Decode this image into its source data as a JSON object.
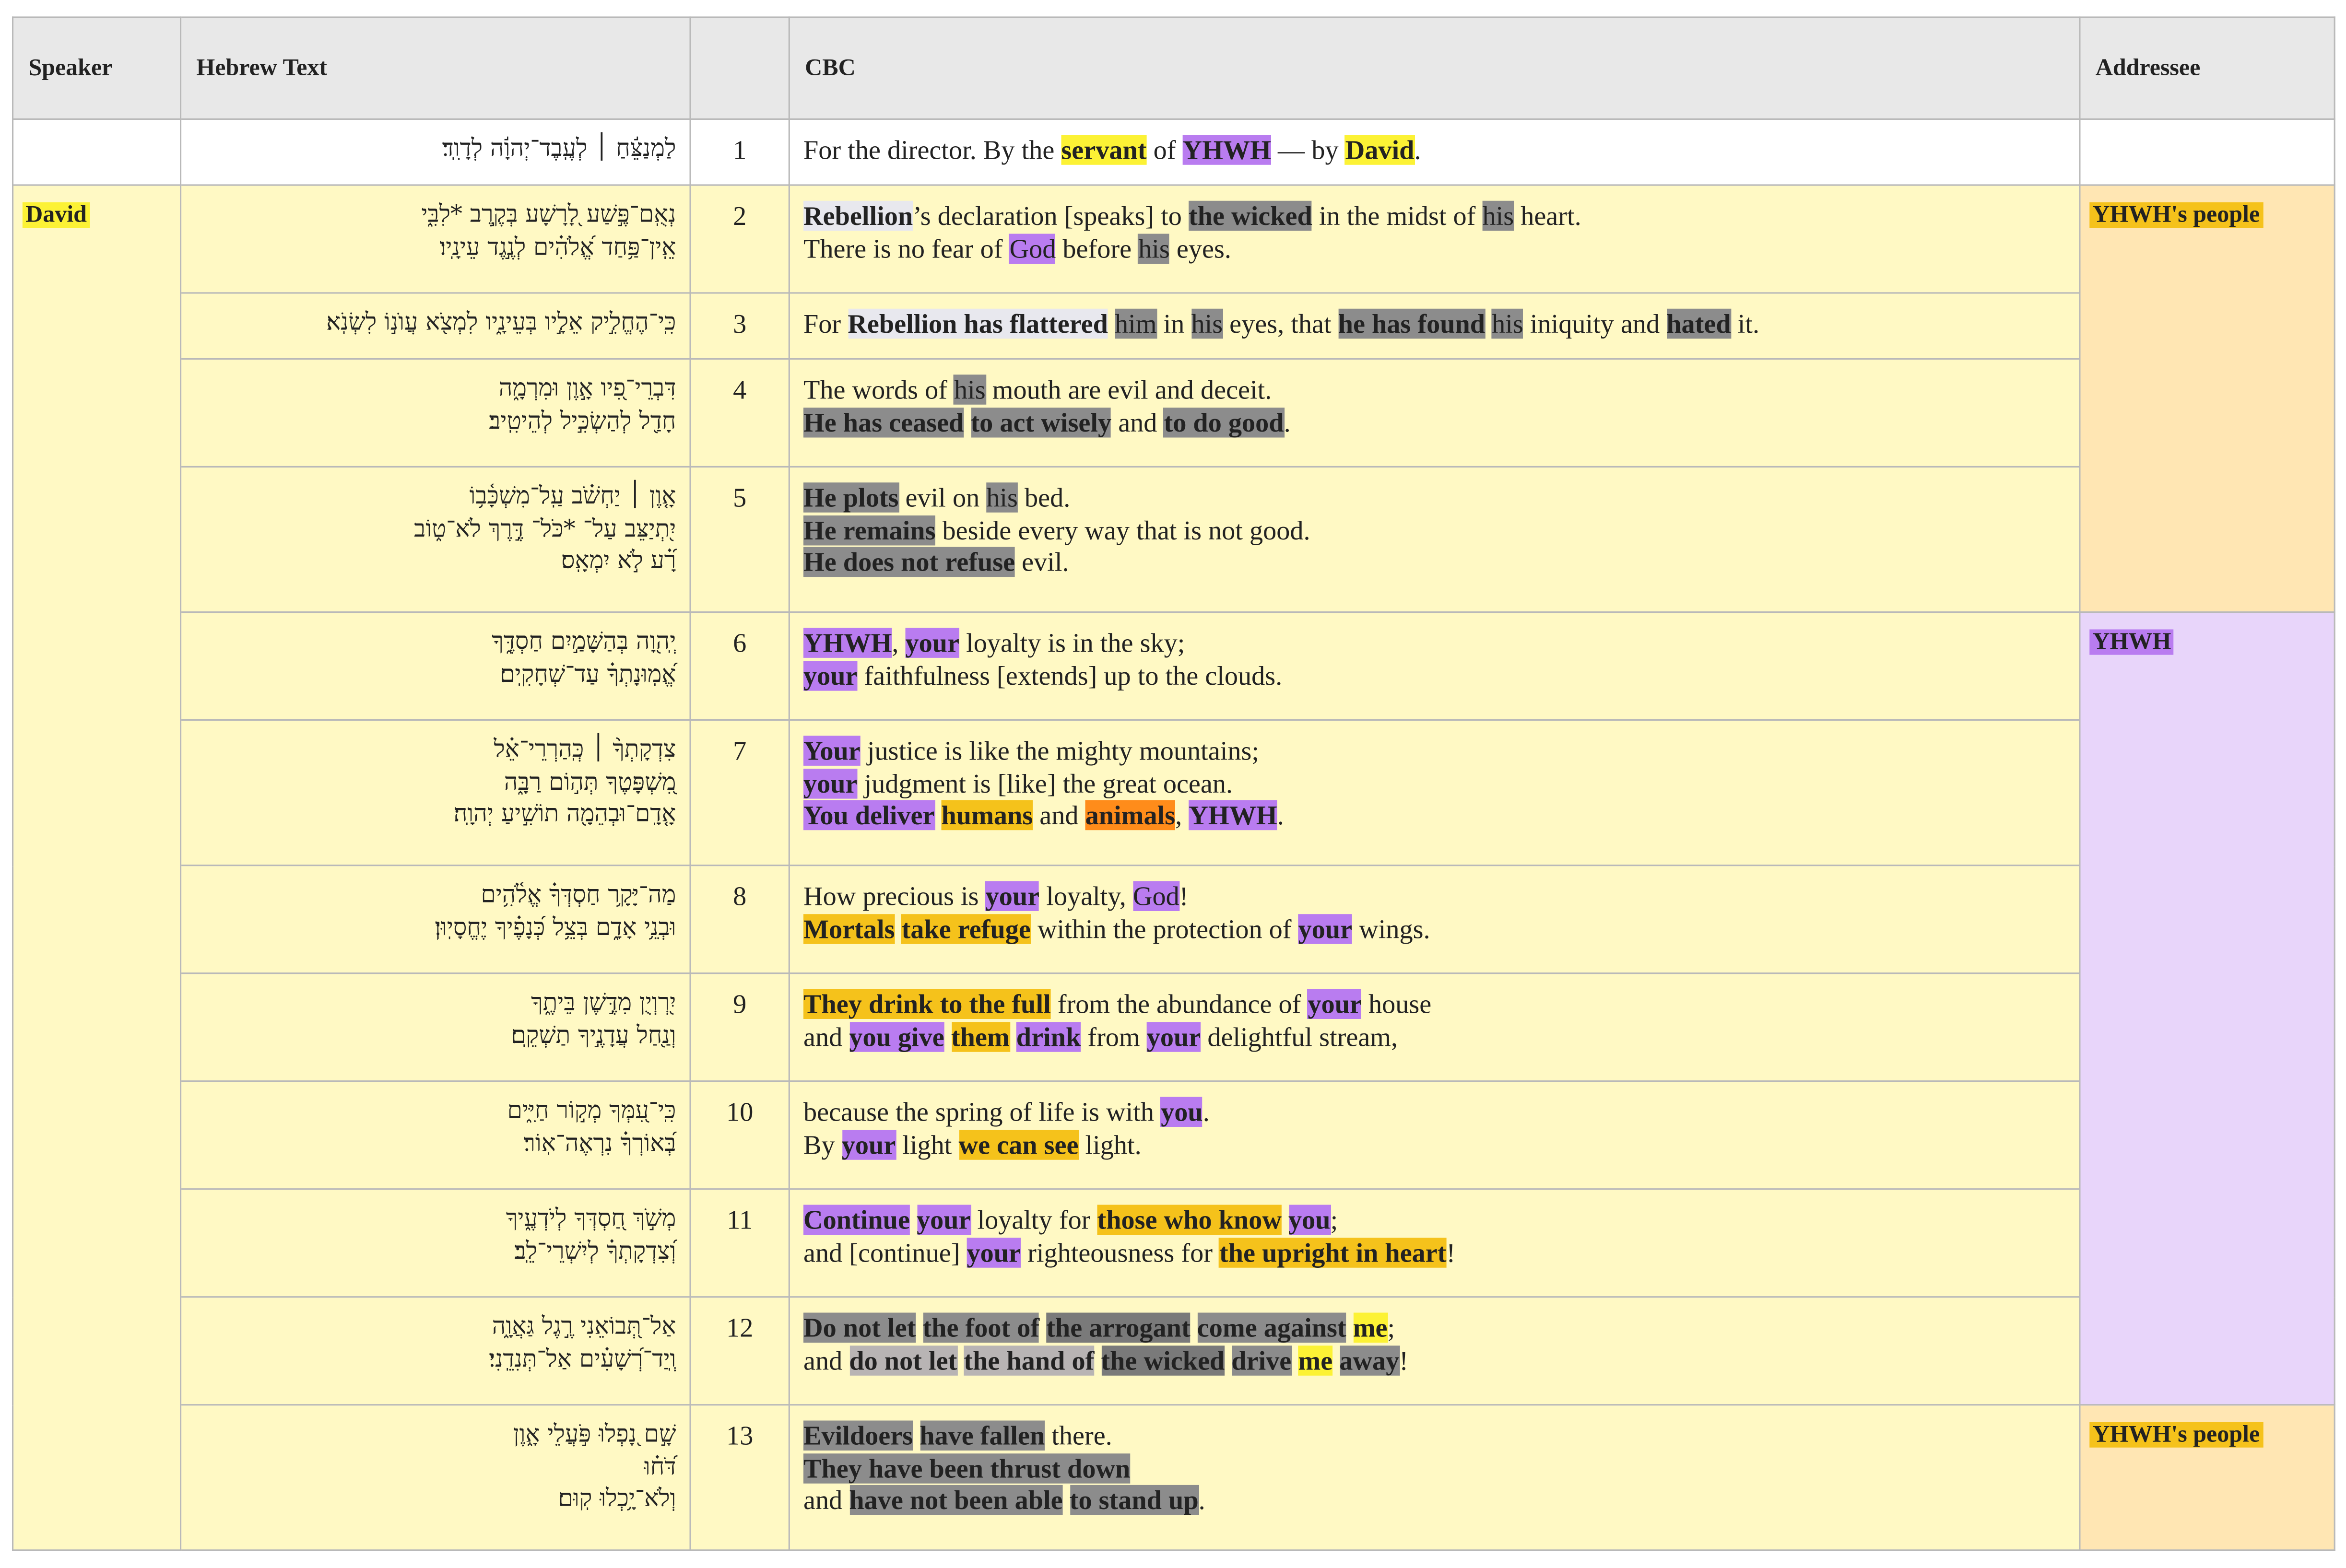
{
  "headers": {
    "speaker": "Speaker",
    "hebrew": "Hebrew Text",
    "number": "",
    "cbc": "CBC",
    "addressee": "Addressee"
  },
  "speaker_label": "David",
  "addressees": {
    "people_1": "YHWH's people",
    "yhwh": "YHWH",
    "people_2": "YHWH's people"
  },
  "colors": {
    "yellow": "#fcf235",
    "purple": "#b97cf0",
    "orange": "#f5c21b",
    "dark_orange": "#ff8c1a",
    "gray": "#8c8c8c",
    "light_gray": "#e8e8ee",
    "row_bg": "#fff9c4",
    "people_bg": "#ffe6b3",
    "yhwh_bg": "#e8d5fa"
  },
  "verses": [
    {
      "n": "1",
      "hebrew": [
        "לַמְנַצֵּ֬חַ ׀ לְעֶֽבֶד־יְהוָ֬ה לְדָוִֽד׃"
      ],
      "cbc": [
        [
          [
            "For the director. By the ",
            ""
          ],
          [
            "servant",
            "yellow b"
          ],
          [
            " of ",
            ""
          ],
          [
            "YHWH",
            "purple b"
          ],
          [
            " — by ",
            ""
          ],
          [
            "David",
            "yellow b"
          ],
          [
            ".",
            ""
          ]
        ]
      ]
    },
    {
      "n": "2",
      "hebrew": [
        "נְאֻֽם־פֶּ֣שַׁע לָ֭רָשָׁע בְּקֶ֣רֶב *לִבִּ֑י",
        "אֵֽין־פַּ֥חַד אֱ֝לֹהִ֗ים לְנֶ֣גֶד עֵינָֽיו׃"
      ],
      "cbc": [
        [
          [
            "Rebellion",
            "lgray b"
          ],
          [
            "’s declaration [speaks] to ",
            ""
          ],
          [
            "the wicked",
            "gray b"
          ],
          [
            " in the midst of ",
            ""
          ],
          [
            "his",
            "gray"
          ],
          [
            " heart.",
            ""
          ]
        ],
        [
          [
            "There is no fear of ",
            ""
          ],
          [
            "God",
            "purple"
          ],
          [
            " before ",
            ""
          ],
          [
            "his",
            "gray"
          ],
          [
            " eyes.",
            ""
          ]
        ]
      ]
    },
    {
      "n": "3",
      "hebrew": [
        "כִּֽי־הֶחֱלִ֣יק אֵלָ֣יו בְּעֵינָ֑יו לִמְצֹ֖א עֲוֺנ֣וֹ לִשְׂנֹֽא׃"
      ],
      "cbc": [
        [
          [
            "For ",
            ""
          ],
          [
            "Rebellion has flattered",
            "lgray b"
          ],
          [
            " ",
            ""
          ],
          [
            "him",
            "gray"
          ],
          [
            " in ",
            ""
          ],
          [
            "his",
            "gray"
          ],
          [
            " eyes, that ",
            ""
          ],
          [
            "he has found",
            "gray b"
          ],
          [
            " ",
            ""
          ],
          [
            "his",
            "gray"
          ],
          [
            " iniquity and ",
            ""
          ],
          [
            "hated",
            "gray b"
          ],
          [
            " it.",
            ""
          ]
        ]
      ]
    },
    {
      "n": "4",
      "hebrew": [
        "דִּבְרֵי־פִ֭יו אָ֣וֶן וּמִרְמָ֑ה",
        "חָדַ֖ל לְהַשְׂכִּ֣יל לְהֵיטִֽיב׃"
      ],
      "cbc": [
        [
          [
            "The words of ",
            ""
          ],
          [
            "his",
            "gray"
          ],
          [
            " mouth are evil and deceit.",
            ""
          ]
        ],
        [
          [
            "He has ceased",
            "gray b"
          ],
          [
            " ",
            ""
          ],
          [
            "to act wisely",
            "gray b"
          ],
          [
            " and ",
            ""
          ],
          [
            "to do good",
            "gray b"
          ],
          [
            ".",
            ""
          ]
        ]
      ]
    },
    {
      "n": "5",
      "hebrew": [
        "אָ֤וֶן ׀ יַחְשֹׁ֗ב עַֽל־מִשְׁכָּ֫ב֥וֹ",
        "יִ֭תְיַצֵּב עַל־ *כֹּל־ דֶּ֣רֶךְ לֹא־ט֑וֹב",
        "רָ֝֗ע לֹ֣א יִמְאָֽס׃"
      ],
      "cbc": [
        [
          [
            "He plots",
            "gray b"
          ],
          [
            " evil on ",
            ""
          ],
          [
            "his",
            "gray"
          ],
          [
            " bed.",
            ""
          ]
        ],
        [
          [
            "He remains",
            "gray b"
          ],
          [
            " beside every way that is not good.",
            ""
          ]
        ],
        [
          [
            "He does not refuse",
            "gray b"
          ],
          [
            " evil.",
            ""
          ]
        ]
      ]
    },
    {
      "n": "6",
      "hebrew": [
        "יְֽהוָ֭ה בְּהַשָּׁמַ֣יִם חַסְדֶּ֑ךָ",
        "אֱ֝מֽוּנָתְךָ֗ עַד־שְׁחָקִֽים׃"
      ],
      "cbc": [
        [
          [
            "YHWH",
            "purple b"
          ],
          [
            ", ",
            ""
          ],
          [
            "your",
            "purple b"
          ],
          [
            " loyalty is in the sky;",
            ""
          ]
        ],
        [
          [
            "your",
            "purple b"
          ],
          [
            " faithfulness [extends] up to the clouds.",
            ""
          ]
        ]
      ]
    },
    {
      "n": "7",
      "hebrew": [
        "צִדְקָתְךָ֨ ׀ כְּֽהַרְרֵי־אֵ֗ל",
        "מִ֭שְׁפָּטֶךָ תְּה֣וֹם רַבָּ֑ה",
        "אָ֤דָֽם־וּבְהֵמָ֖ה תוֹשִׁ֣יעַ יְהוָֽה׃"
      ],
      "cbc": [
        [
          [
            "Your",
            "purple b"
          ],
          [
            " justice is like the mighty mountains;",
            ""
          ]
        ],
        [
          [
            "your",
            "purple b"
          ],
          [
            " judgment is [like] the great ocean.",
            ""
          ]
        ],
        [
          [
            "You deliver",
            "purple b"
          ],
          [
            " ",
            ""
          ],
          [
            "humans",
            "orange b"
          ],
          [
            " and ",
            ""
          ],
          [
            "animals",
            "dorange b"
          ],
          [
            ", ",
            ""
          ],
          [
            "YHWH",
            "purple b"
          ],
          [
            ".",
            ""
          ]
        ]
      ]
    },
    {
      "n": "8",
      "hebrew": [
        "מַה־יָּקָ֥ר חַסְדְּךָ֗ אֱלֹ֫הִ֥ים",
        "וּבְנֵ֥י אָדָ֑ם בְּצֵ֥ל כְּ֝נָפֶ֗יךָ יֶחֱסָיֽוּן׃"
      ],
      "cbc": [
        [
          [
            "How precious is ",
            ""
          ],
          [
            "your",
            "purple b"
          ],
          [
            " loyalty, ",
            ""
          ],
          [
            "God",
            "purple"
          ],
          [
            "!",
            ""
          ]
        ],
        [
          [
            "Mortals",
            "orange b"
          ],
          [
            " ",
            ""
          ],
          [
            "take refuge",
            "orange b"
          ],
          [
            " within the protection of ",
            ""
          ],
          [
            "your",
            "purple b"
          ],
          [
            " wings.",
            ""
          ]
        ]
      ]
    },
    {
      "n": "9",
      "hebrew": [
        "יִ֭רְוְיֻן מִדֶּ֣שֶׁן בֵּיתֶ֑ךָ",
        "וְנַ֖חַל עֲדָנֶ֣יךָ תַשְׁקֵֽם׃"
      ],
      "cbc": [
        [
          [
            "They drink to the full",
            "orange b"
          ],
          [
            " from the abundance of ",
            ""
          ],
          [
            "your",
            "purple b"
          ],
          [
            " house",
            ""
          ]
        ],
        [
          [
            "and ",
            ""
          ],
          [
            "you give",
            "purple b"
          ],
          [
            " ",
            ""
          ],
          [
            "them",
            "orange b"
          ],
          [
            " ",
            ""
          ],
          [
            "drink",
            "purple b"
          ],
          [
            " from ",
            ""
          ],
          [
            "your",
            "purple b"
          ],
          [
            " delightful stream,",
            ""
          ]
        ]
      ]
    },
    {
      "n": "10",
      "hebrew": [
        "כִּֽי־עִ֭מְּךָ מְק֣וֹר חַיִּ֑ים",
        "בְּ֝אוֹרְךָ֗ נִרְאֶה־אֽוֹר׃"
      ],
      "cbc": [
        [
          [
            "because the spring of life is with ",
            ""
          ],
          [
            "you",
            "purple b"
          ],
          [
            ".",
            ""
          ]
        ],
        [
          [
            "By ",
            ""
          ],
          [
            "your",
            "purple b"
          ],
          [
            " light ",
            ""
          ],
          [
            "we can see",
            "orange b"
          ],
          [
            " light.",
            ""
          ]
        ]
      ]
    },
    {
      "n": "11",
      "hebrew": [
        "מְשֹׁ֣ךְ חַ֭סְדְּךָ לְיֹדְעֶ֑יךָ",
        "וְ֝צִדְקָתְךָ֗ לְיִשְׁרֵי־לֵֽב׃"
      ],
      "cbc": [
        [
          [
            "Continue",
            "purple b"
          ],
          [
            " ",
            ""
          ],
          [
            "your",
            "purple b"
          ],
          [
            " loyalty for ",
            ""
          ],
          [
            "those who know",
            "orange b"
          ],
          [
            " ",
            ""
          ],
          [
            "you",
            "purple b"
          ],
          [
            ";",
            ""
          ]
        ],
        [
          [
            "and [continue] ",
            ""
          ],
          [
            "your",
            "purple b"
          ],
          [
            " righteousness for ",
            ""
          ],
          [
            "the upright in heart",
            "orange b"
          ],
          [
            "!",
            ""
          ]
        ]
      ]
    },
    {
      "n": "12",
      "hebrew": [
        "אַל־תְּ֭בוֹאֵנִי רֶ֣גֶל גַּאֲוָ֑ה",
        "וְֽיַד־רְ֝שָׁעִ֗ים אַל־תְּנִדֵֽנִי׃"
      ],
      "cbc": [
        [
          [
            "Do not let",
            "gray b"
          ],
          [
            " ",
            ""
          ],
          [
            "the foot of",
            "gray b"
          ],
          [
            " ",
            ""
          ],
          [
            "the arrogant",
            "dgray b"
          ],
          [
            " ",
            ""
          ],
          [
            "come against",
            "gray b"
          ],
          [
            " ",
            ""
          ],
          [
            "me",
            "yellow b"
          ],
          [
            ";",
            ""
          ]
        ],
        [
          [
            "and ",
            ""
          ],
          [
            "do not let",
            "mgray b"
          ],
          [
            " ",
            ""
          ],
          [
            "the hand of",
            "mgray b"
          ],
          [
            " ",
            ""
          ],
          [
            "the wicked",
            "dgray b"
          ],
          [
            " ",
            ""
          ],
          [
            "drive",
            "gray b"
          ],
          [
            " ",
            ""
          ],
          [
            "me",
            "yellow b"
          ],
          [
            " ",
            ""
          ],
          [
            "away",
            "gray b"
          ],
          [
            "!",
            ""
          ]
        ]
      ]
    },
    {
      "n": "13",
      "hebrew": [
        "שָׁ֣ם נָ֭פְלוּ פֹּ֣עֲלֵי אָ֑וֶן",
        "דֹּ֝ח֗וּ",
        "וְלֹא־יָ֥כְלוּ קֽוּם׃"
      ],
      "cbc": [
        [
          [
            "Evildoers",
            "gray b"
          ],
          [
            " ",
            ""
          ],
          [
            "have fallen",
            "gray b"
          ],
          [
            " there.",
            ""
          ]
        ],
        [
          [
            "They have been thrust down",
            "gray b"
          ]
        ],
        [
          [
            "and ",
            ""
          ],
          [
            "have not been able",
            "gray b"
          ],
          [
            " ",
            ""
          ],
          [
            "to stand up",
            "gray b"
          ],
          [
            ".",
            ""
          ]
        ]
      ]
    }
  ]
}
